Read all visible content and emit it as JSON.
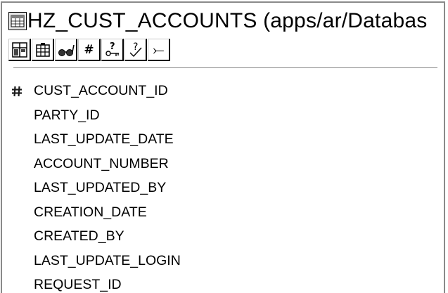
{
  "window": {
    "title": "HZ_CUST_ACCOUNTS (apps/ar/Databas",
    "icon": "table-icon"
  },
  "toolbar": {
    "buttons": [
      {
        "name": "properties-button",
        "icon": "properties-icon",
        "glyph": ""
      },
      {
        "name": "columns-button",
        "icon": "grid-icon",
        "glyph": ""
      },
      {
        "name": "view-button",
        "icon": "glasses-icon",
        "glyph": ""
      },
      {
        "name": "primary-key-button",
        "icon": "hash-icon",
        "glyph": "#"
      },
      {
        "name": "unique-key-button",
        "icon": "key-question-icon",
        "glyph": ""
      },
      {
        "name": "check-constraint-button",
        "icon": "check-question-icon",
        "glyph": ""
      },
      {
        "name": "foreign-key-button",
        "icon": "fork-arrow-icon",
        "glyph": "⤚"
      }
    ]
  },
  "columns": [
    {
      "name": "CUST_ACCOUNT_ID",
      "primary_key": true
    },
    {
      "name": "PARTY_ID",
      "primary_key": false
    },
    {
      "name": "LAST_UPDATE_DATE",
      "primary_key": false
    },
    {
      "name": "ACCOUNT_NUMBER",
      "primary_key": false
    },
    {
      "name": "LAST_UPDATED_BY",
      "primary_key": false
    },
    {
      "name": "CREATION_DATE",
      "primary_key": false
    },
    {
      "name": "CREATED_BY",
      "primary_key": false
    },
    {
      "name": "LAST_UPDATE_LOGIN",
      "primary_key": false
    },
    {
      "name": "REQUEST_ID",
      "primary_key": false
    }
  ],
  "colors": {
    "frame": "#8a8a8a",
    "separator": "#888888",
    "key_icon": "#1a1a1a"
  }
}
